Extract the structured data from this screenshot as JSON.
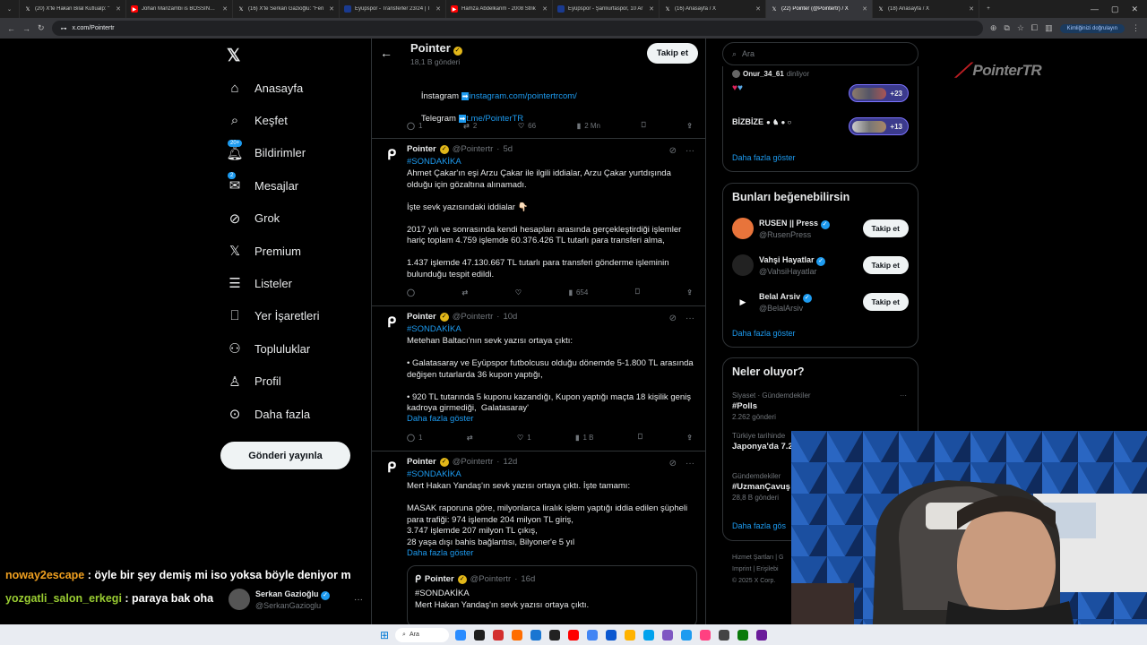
{
  "browser": {
    "tabs": [
      {
        "label": "(20) X'te Hakan Bilal Kutlualp: \"",
        "icon": "x-icon",
        "color": "#ffffff"
      },
      {
        "label": "Johan Manzambi is BOSSING in",
        "icon": "youtube-icon",
        "color": "#ff0000"
      },
      {
        "label": "(16) X'te Serkan Gazioğlu: \"Fen",
        "icon": "x-icon",
        "color": "#ffffff"
      },
      {
        "label": "Eyüpspor - Transferler 23/24 | T",
        "icon": "tm-icon",
        "color": "#1a3a8f"
      },
      {
        "label": "Hamza Abdelkarim - 2008 Strik",
        "icon": "youtube-icon",
        "color": "#ff0000"
      },
      {
        "label": "Eyüpspor - Şanlıurfaspor, 10 Ar",
        "icon": "tm-icon",
        "color": "#1a3a8f"
      },
      {
        "label": "(16) Anasayfa / X",
        "icon": "x-icon",
        "color": "#ffffff"
      },
      {
        "label": "(22) Pointer (@Pointertr) / X",
        "icon": "x-icon",
        "color": "#ffffff",
        "active": true
      },
      {
        "label": "(18) Anasayfa / X",
        "icon": "x-icon",
        "color": "#ffffff"
      }
    ],
    "url": "x.com/Pointertr",
    "profile_pill": "Kimliğinizi doğrulayın"
  },
  "sidebar": {
    "items": [
      {
        "label": "Anasayfa",
        "icon": "home-icon"
      },
      {
        "label": "Keşfet",
        "icon": "search-icon"
      },
      {
        "label": "Bildirimler",
        "icon": "bell-icon",
        "badge": "20+"
      },
      {
        "label": "Mesajlar",
        "icon": "mail-icon",
        "badge": "2"
      },
      {
        "label": "Grok",
        "icon": "grok-icon"
      },
      {
        "label": "Premium",
        "icon": "x-logo-icon"
      },
      {
        "label": "Listeler",
        "icon": "list-icon"
      },
      {
        "label": "Yer İşaretleri",
        "icon": "bookmark-icon"
      },
      {
        "label": "Topluluklar",
        "icon": "people-icon"
      },
      {
        "label": "Profil",
        "icon": "person-icon"
      },
      {
        "label": "Daha fazla",
        "icon": "more-circle-icon"
      }
    ],
    "post_button": "Gönderi yayınla"
  },
  "profile_header": {
    "name": "Pointer",
    "posts_count": "18,1 B gönderi",
    "follow_label": "Takip et"
  },
  "pinned": {
    "instagram_prefix": "İnstagram ",
    "instagram_link": "instagram.com/pointertrcom/",
    "telegram_prefix": "Telegram ",
    "telegram_link": "t.me/PointerTR",
    "stats": {
      "replies": "1",
      "reposts": "2",
      "likes": "66",
      "views": "2 Mn"
    }
  },
  "tweets": [
    {
      "name": "Pointer",
      "handle": "@Pointertr",
      "time": "5d",
      "hashtag": "#SONDAKİKA",
      "text": "Ahmet Çakar'ın eşi Arzu Çakar ile ilgili iddialar, Arzu Çakar yurtdışında olduğu için gözaltına alınamadı.\n\nİşte sevk yazısındaki iddialar 👇🏻\n\n2017 yılı ve sonrasında kendi hesapları arasında gerçekleştirdiği işlemler hariç toplam 4.759 işlemde 60.376.426 TL tutarlı para transferi alma,\n\n1.437 işlemde 47.130.667 TL tutarlı para transferi gönderme işleminin bulunduğu tespit edildi.",
      "show_more": "",
      "stats": {
        "replies": "",
        "reposts": "",
        "likes": "",
        "views": "654"
      }
    },
    {
      "name": "Pointer",
      "handle": "@Pointertr",
      "time": "10d",
      "hashtag": "#SONDAKİKA",
      "text": "Metehan Baltacı'nın sevk yazısı ortaya çıktı:\n\n• Galatasaray ve Eyüpspor futbolcusu olduğu dönemde 5-1.800 TL arasında değişen tutarlarda 36 kupon yaptığı,\n\n• 920 TL tutarında 5 kuponu kazandığı, Kupon yaptığı maçta 18 kişilik geniş kadroya girmediği,  Galatasaray'",
      "show_more": "Daha fazla göster",
      "stats": {
        "replies": "1",
        "reposts": "",
        "likes": "1",
        "views": "1 B"
      }
    },
    {
      "name": "Pointer",
      "handle": "@Pointertr",
      "time": "12d",
      "hashtag": "#SONDAKİKA",
      "text": "Mert Hakan Yandaş'ın sevk yazısı ortaya çıktı. İşte tamamı:\n\nMASAK raporuna göre, milyonlarca liralık işlem yaptığı iddia edilen şüpheli para trafiği: 974 işlemde 204 milyon TL giriş,\n3.747 işlemde 207 milyon TL çıkış,\n28 yaşa dışı bahis bağlantısı, Bilyoner'e 5 yıl",
      "show_more": "Daha fazla göster",
      "quote": {
        "name": "Pointer",
        "handle": "@Pointertr",
        "time": "16d",
        "hashtag": "#SONDAKİKA",
        "text": "Mert Hakan Yandaş'ın sevk yazısı ortaya çıktı."
      }
    }
  ],
  "right": {
    "search_placeholder": "Ara",
    "spaces": {
      "listener_name": "Onur_34_61",
      "listener_suffix": " dinliyor",
      "space1_count": "+23",
      "space2_title": "BİZBİZE",
      "space2_count": "+13",
      "show_more": "Daha fazla göster"
    },
    "who_to_follow": {
      "title": "Bunları beğenebilirsin",
      "accounts": [
        {
          "name": "RUSEN || Press",
          "handle": "@RusenPress",
          "button": "Takip et",
          "color": "#e8743b"
        },
        {
          "name": "Vahşi Hayatlar",
          "handle": "@VahsiHayatlar",
          "button": "Takip et",
          "color": "#222222"
        },
        {
          "name": "Belal Arsiv",
          "handle": "@BelalArsiv",
          "button": "Takip et",
          "color": "#000000"
        }
      ],
      "show_more": "Daha fazla göster"
    },
    "trends": {
      "title": "Neler oluyor?",
      "items": [
        {
          "meta": "Siyaset · Gündemdekiler",
          "topic": "#Polls",
          "count": "2.262 gönderi"
        },
        {
          "meta": "Türkiye tarihinde",
          "topic": "Japonya'da 7.2",
          "count": ""
        },
        {
          "meta": "Gündemdekiler",
          "topic": "#UzmanÇavuş",
          "count": "28,8 B gönderi"
        }
      ],
      "show_more": "Daha fazla gös"
    },
    "footer": {
      "line1": "Hizmet Şartları  |  G",
      "line2": "Imprint  |  Erişilebi",
      "line3": "© 2025 X Corp."
    }
  },
  "chat": [
    {
      "user": "noway2escape",
      "user_color": "#f0a020",
      "message": " : öyle bir şey demiş mi iso yoksa böyle deniyor m"
    },
    {
      "user": "yozgatli_salon_erkegi",
      "user_color": "#9acd32",
      "message": " : paraya bak oha"
    }
  ],
  "floating_account": {
    "name": "Serkan Gazioğlu",
    "handle": "@SerkanGazioglu"
  },
  "taskbar": {
    "search_label": "Ara"
  },
  "watermark": "PointerTR"
}
